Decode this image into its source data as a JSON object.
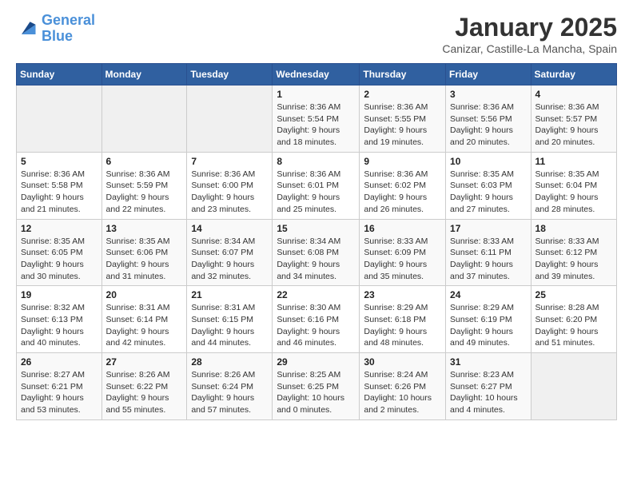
{
  "header": {
    "logo_line1": "General",
    "logo_line2": "Blue",
    "title": "January 2025",
    "subtitle": "Canizar, Castille-La Mancha, Spain"
  },
  "days_of_week": [
    "Sunday",
    "Monday",
    "Tuesday",
    "Wednesday",
    "Thursday",
    "Friday",
    "Saturday"
  ],
  "weeks": [
    [
      {
        "day": "",
        "info": ""
      },
      {
        "day": "",
        "info": ""
      },
      {
        "day": "",
        "info": ""
      },
      {
        "day": "1",
        "info": "Sunrise: 8:36 AM\nSunset: 5:54 PM\nDaylight: 9 hours\nand 18 minutes."
      },
      {
        "day": "2",
        "info": "Sunrise: 8:36 AM\nSunset: 5:55 PM\nDaylight: 9 hours\nand 19 minutes."
      },
      {
        "day": "3",
        "info": "Sunrise: 8:36 AM\nSunset: 5:56 PM\nDaylight: 9 hours\nand 20 minutes."
      },
      {
        "day": "4",
        "info": "Sunrise: 8:36 AM\nSunset: 5:57 PM\nDaylight: 9 hours\nand 20 minutes."
      }
    ],
    [
      {
        "day": "5",
        "info": "Sunrise: 8:36 AM\nSunset: 5:58 PM\nDaylight: 9 hours\nand 21 minutes."
      },
      {
        "day": "6",
        "info": "Sunrise: 8:36 AM\nSunset: 5:59 PM\nDaylight: 9 hours\nand 22 minutes."
      },
      {
        "day": "7",
        "info": "Sunrise: 8:36 AM\nSunset: 6:00 PM\nDaylight: 9 hours\nand 23 minutes."
      },
      {
        "day": "8",
        "info": "Sunrise: 8:36 AM\nSunset: 6:01 PM\nDaylight: 9 hours\nand 25 minutes."
      },
      {
        "day": "9",
        "info": "Sunrise: 8:36 AM\nSunset: 6:02 PM\nDaylight: 9 hours\nand 26 minutes."
      },
      {
        "day": "10",
        "info": "Sunrise: 8:35 AM\nSunset: 6:03 PM\nDaylight: 9 hours\nand 27 minutes."
      },
      {
        "day": "11",
        "info": "Sunrise: 8:35 AM\nSunset: 6:04 PM\nDaylight: 9 hours\nand 28 minutes."
      }
    ],
    [
      {
        "day": "12",
        "info": "Sunrise: 8:35 AM\nSunset: 6:05 PM\nDaylight: 9 hours\nand 30 minutes."
      },
      {
        "day": "13",
        "info": "Sunrise: 8:35 AM\nSunset: 6:06 PM\nDaylight: 9 hours\nand 31 minutes."
      },
      {
        "day": "14",
        "info": "Sunrise: 8:34 AM\nSunset: 6:07 PM\nDaylight: 9 hours\nand 32 minutes."
      },
      {
        "day": "15",
        "info": "Sunrise: 8:34 AM\nSunset: 6:08 PM\nDaylight: 9 hours\nand 34 minutes."
      },
      {
        "day": "16",
        "info": "Sunrise: 8:33 AM\nSunset: 6:09 PM\nDaylight: 9 hours\nand 35 minutes."
      },
      {
        "day": "17",
        "info": "Sunrise: 8:33 AM\nSunset: 6:11 PM\nDaylight: 9 hours\nand 37 minutes."
      },
      {
        "day": "18",
        "info": "Sunrise: 8:33 AM\nSunset: 6:12 PM\nDaylight: 9 hours\nand 39 minutes."
      }
    ],
    [
      {
        "day": "19",
        "info": "Sunrise: 8:32 AM\nSunset: 6:13 PM\nDaylight: 9 hours\nand 40 minutes."
      },
      {
        "day": "20",
        "info": "Sunrise: 8:31 AM\nSunset: 6:14 PM\nDaylight: 9 hours\nand 42 minutes."
      },
      {
        "day": "21",
        "info": "Sunrise: 8:31 AM\nSunset: 6:15 PM\nDaylight: 9 hours\nand 44 minutes."
      },
      {
        "day": "22",
        "info": "Sunrise: 8:30 AM\nSunset: 6:16 PM\nDaylight: 9 hours\nand 46 minutes."
      },
      {
        "day": "23",
        "info": "Sunrise: 8:29 AM\nSunset: 6:18 PM\nDaylight: 9 hours\nand 48 minutes."
      },
      {
        "day": "24",
        "info": "Sunrise: 8:29 AM\nSunset: 6:19 PM\nDaylight: 9 hours\nand 49 minutes."
      },
      {
        "day": "25",
        "info": "Sunrise: 8:28 AM\nSunset: 6:20 PM\nDaylight: 9 hours\nand 51 minutes."
      }
    ],
    [
      {
        "day": "26",
        "info": "Sunrise: 8:27 AM\nSunset: 6:21 PM\nDaylight: 9 hours\nand 53 minutes."
      },
      {
        "day": "27",
        "info": "Sunrise: 8:26 AM\nSunset: 6:22 PM\nDaylight: 9 hours\nand 55 minutes."
      },
      {
        "day": "28",
        "info": "Sunrise: 8:26 AM\nSunset: 6:24 PM\nDaylight: 9 hours\nand 57 minutes."
      },
      {
        "day": "29",
        "info": "Sunrise: 8:25 AM\nSunset: 6:25 PM\nDaylight: 10 hours\nand 0 minutes."
      },
      {
        "day": "30",
        "info": "Sunrise: 8:24 AM\nSunset: 6:26 PM\nDaylight: 10 hours\nand 2 minutes."
      },
      {
        "day": "31",
        "info": "Sunrise: 8:23 AM\nSunset: 6:27 PM\nDaylight: 10 hours\nand 4 minutes."
      },
      {
        "day": "",
        "info": ""
      }
    ]
  ]
}
